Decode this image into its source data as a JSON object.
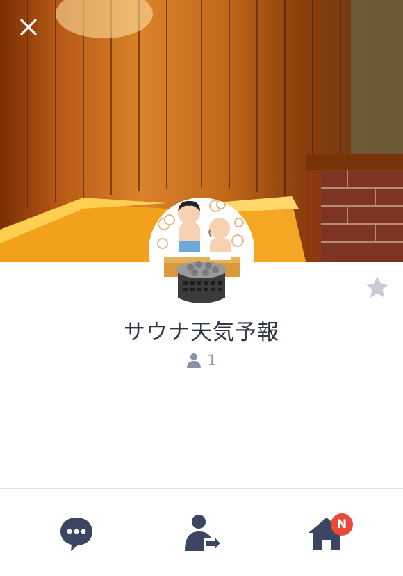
{
  "profile": {
    "name": "サウナ天気予報",
    "follower_count": "1"
  },
  "actions": {
    "close": "close-icon",
    "favorite": "star-icon",
    "chat": "chat-icon",
    "share": "share-contact-icon",
    "home": "home-icon",
    "home_badge": "N"
  },
  "colors": {
    "text_primary": "#2f3542",
    "icon_dark": "#3c4663",
    "badge": "#e84a3c",
    "star": "#c8ccd4"
  }
}
